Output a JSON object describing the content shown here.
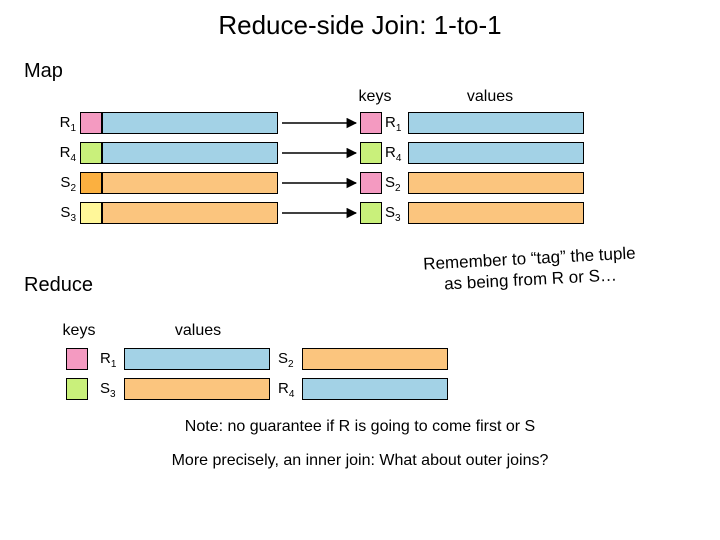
{
  "title": "Reduce-side Join: 1-to-1",
  "section": {
    "map": "Map",
    "reduce": "Reduce"
  },
  "headers": {
    "keys": "keys",
    "values": "values"
  },
  "labels": {
    "R1": "R",
    "R1s": "1",
    "R4": "R",
    "R4s": "4",
    "S2": "S",
    "S2s": "2",
    "S3": "S",
    "S3s": "3"
  },
  "tagnote_l1": "Remember to “tag” the tuple",
  "tagnote_l2": "as being from R or S…",
  "footnote": "Note: no guarantee if R is going to come first or S",
  "footnote2": "More precisely, an inner join: What about outer joins?",
  "colors": {
    "pink": "#f49ac1",
    "lime": "#c9f07b",
    "blue": "#a3d2e6",
    "orange": "#fbb040",
    "yellow": "#fff799",
    "lorange": "#fbc57e"
  }
}
